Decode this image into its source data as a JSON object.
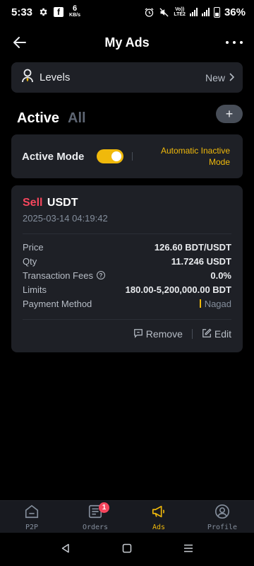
{
  "status_bar": {
    "time": "5:33",
    "speed_value": "6",
    "speed_unit": "KB/s",
    "volte_top": "Vo))",
    "volte_bottom": "LTE2",
    "battery": "36%",
    "icons": [
      "gear-icon",
      "facebook-icon",
      "alarm-icon",
      "mute-icon",
      "signal-icon",
      "battery-icon"
    ]
  },
  "header": {
    "title": "My Ads"
  },
  "levels": {
    "label": "Levels",
    "value": "New"
  },
  "tabs": [
    {
      "label": "Active",
      "selected": true
    },
    {
      "label": "All",
      "selected": false
    }
  ],
  "add_button": {
    "label": "+"
  },
  "mode": {
    "label": "Active Mode",
    "toggle_on": true,
    "link": "Automatic Inactive Mode"
  },
  "ad": {
    "side": "Sell",
    "asset": "USDT",
    "date": "2025-03-14 04:19:42",
    "rows": [
      {
        "label": "Price",
        "value": "126.60 BDT/USDT"
      },
      {
        "label": "Qty",
        "value": "11.7246 USDT"
      },
      {
        "label": "Transaction Fees",
        "value": "0.0%"
      },
      {
        "label": "Limits",
        "value": "180.00-5,200,000.00 BDT"
      }
    ],
    "payment_label": "Payment Method",
    "payment_value": "Nagad",
    "actions": {
      "remove": "Remove",
      "edit": "Edit"
    }
  },
  "bottom_nav": [
    {
      "label": "P2P",
      "icon": "home-icon"
    },
    {
      "label": "Orders",
      "icon": "orders-icon",
      "badge": "1"
    },
    {
      "label": "Ads",
      "icon": "megaphone-icon",
      "active": true
    },
    {
      "label": "Profile",
      "icon": "profile-icon"
    }
  ],
  "colors": {
    "accent": "#f0b90b",
    "sell": "#f6465d",
    "card": "#1e2026"
  }
}
